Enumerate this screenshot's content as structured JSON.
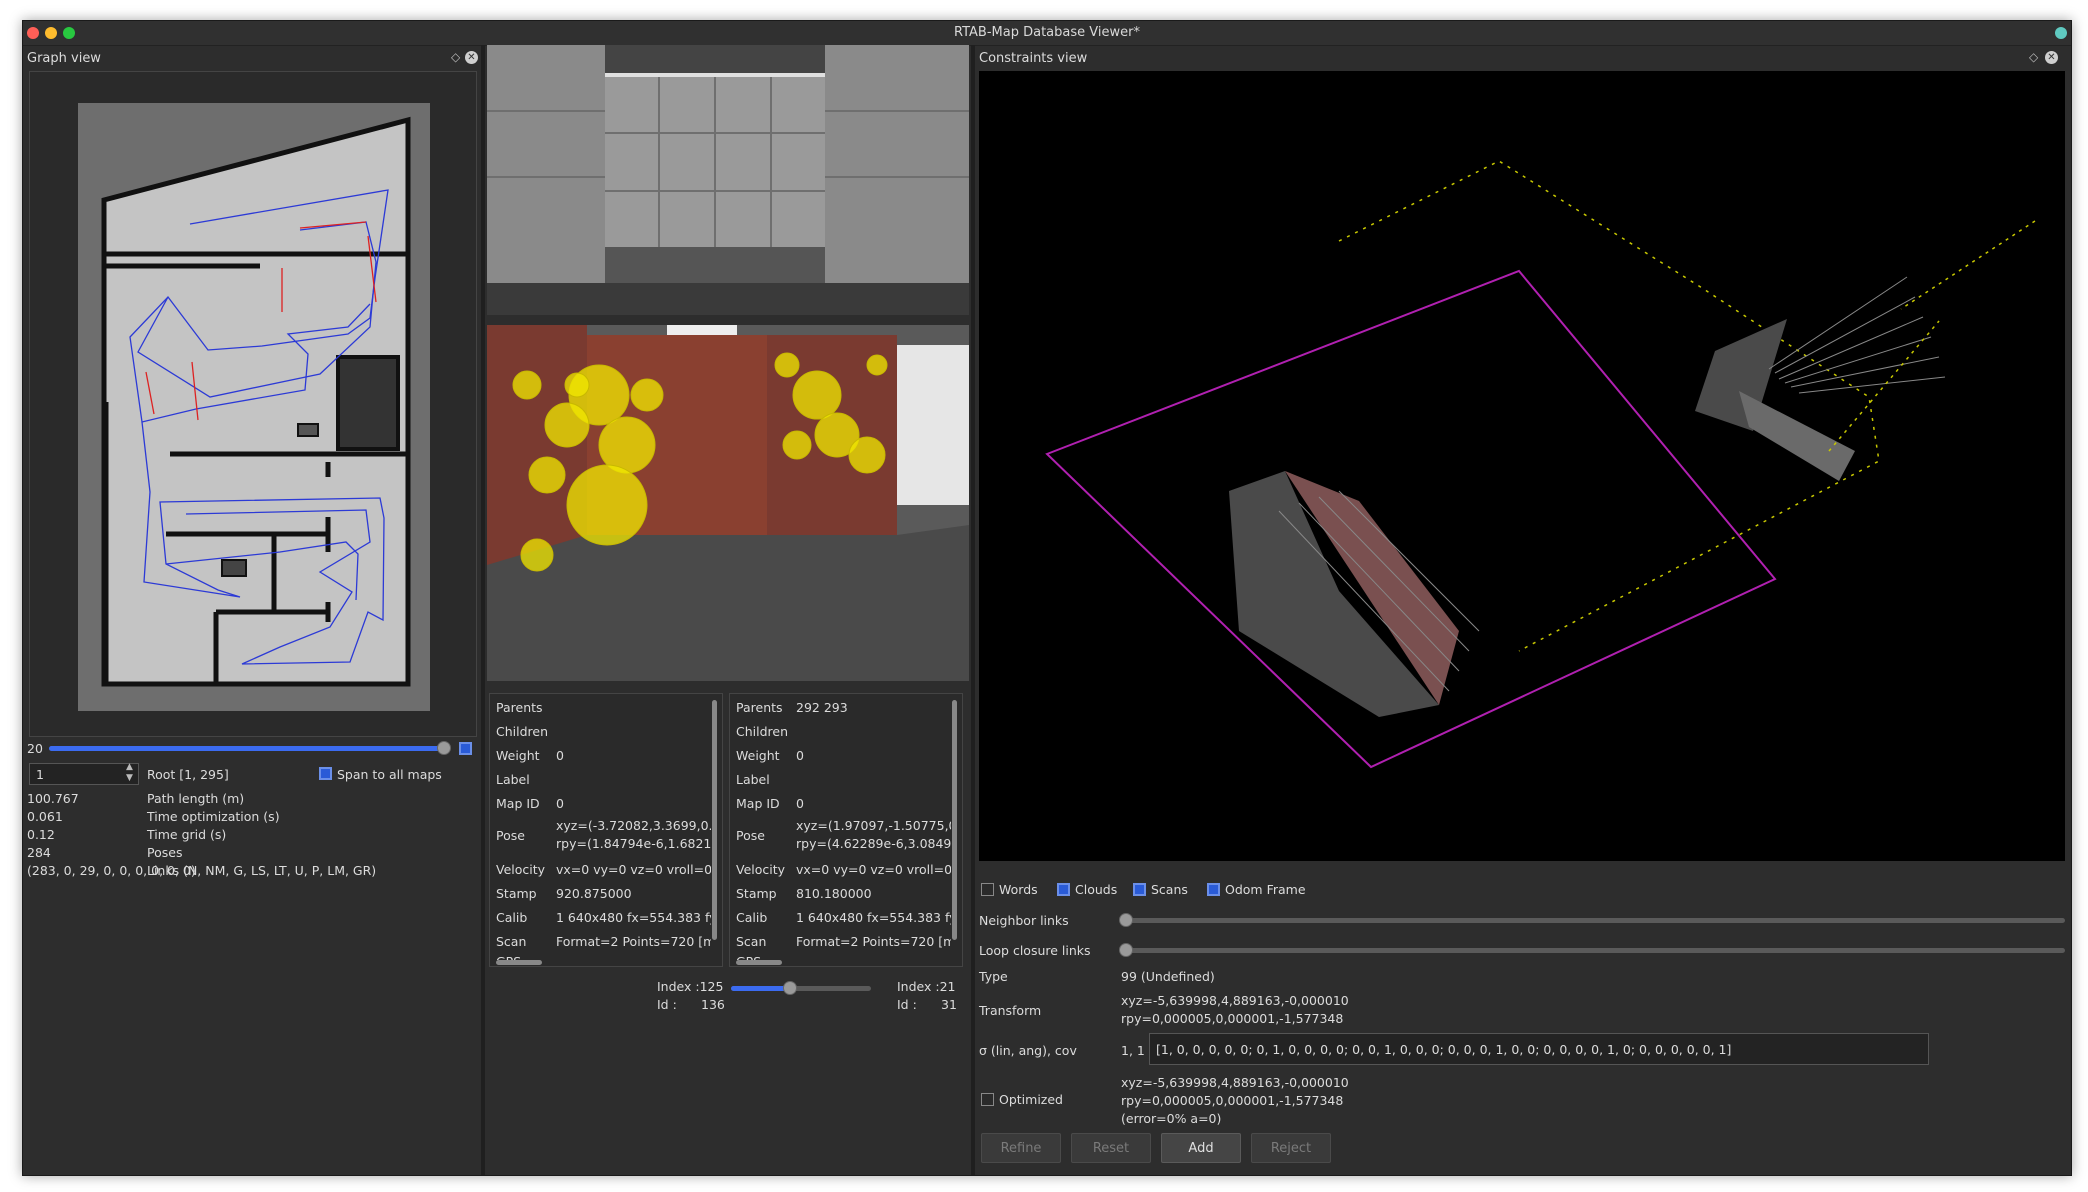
{
  "window": {
    "title": "RTAB-Map Database Viewer*"
  },
  "graph_view": {
    "title": "Graph view",
    "slider_value": "20",
    "spin_value": "1",
    "root_label": "Root [1, 295]",
    "span_label": "Span to all maps",
    "stats": [
      {
        "value": "100.767",
        "label": "Path length (m)"
      },
      {
        "value": "0.061",
        "label": "Time optimization (s)"
      },
      {
        "value": "0.12",
        "label": "Time grid (s)"
      },
      {
        "value": "284",
        "label": "Poses"
      },
      {
        "value": "(283, 0, 29, 0, 0, 0, 0, 0, 0)",
        "label": "Links (N, NM, G, LS, LT, U, P, LM, GR)"
      }
    ]
  },
  "node_a": {
    "rows": [
      {
        "key": "Parents",
        "value": ""
      },
      {
        "key": "Children",
        "value": ""
      },
      {
        "key": "Weight",
        "value": "0"
      },
      {
        "key": "Label",
        "value": ""
      },
      {
        "key": "Map ID",
        "value": "0"
      },
      {
        "key": "Pose",
        "value": "xyz=(-3.72082,3.3699,0.1(",
        "value2": "rpy=(1.84794e-6,1.68211e"
      },
      {
        "key": "Velocity",
        "value": "vx=0 vy=0 vz=0 vroll=0 vp"
      },
      {
        "key": "Stamp",
        "value": "920.875000"
      },
      {
        "key": "Calib",
        "value": "1 640x480 fx=554.383 fy="
      },
      {
        "key": "Scan",
        "value": "Format=2 Points=720 [ma"
      },
      {
        "key": "GPS",
        "value": ""
      }
    ],
    "index_label": "Index :125",
    "id_label": "Id :",
    "id_value": "136",
    "slider_fraction": 0.42
  },
  "node_b": {
    "rows": [
      {
        "key": "Parents",
        "value": "292 293"
      },
      {
        "key": "Children",
        "value": ""
      },
      {
        "key": "Weight",
        "value": "0"
      },
      {
        "key": "Label",
        "value": ""
      },
      {
        "key": "Map ID",
        "value": "0"
      },
      {
        "key": "Pose",
        "value": "xyz=(1.97097,-1.50775,0.1",
        "value2": "rpy=(4.62289e-6,3.0849e-"
      },
      {
        "key": "Velocity",
        "value": "vx=0 vy=0 vz=0 vroll=0 vp"
      },
      {
        "key": "Stamp",
        "value": "810.180000"
      },
      {
        "key": "Calib",
        "value": "1 640x480 fx=554.383 fy="
      },
      {
        "key": "Scan",
        "value": "Format=2 Points=720 [ma"
      },
      {
        "key": "GPS",
        "value": ""
      }
    ],
    "index_label": "Index :21",
    "id_label": "Id :",
    "id_value": "31",
    "slider_fraction": 0.07
  },
  "constraints_view": {
    "title": "Constraints view",
    "checkboxes": [
      {
        "label": "Words",
        "checked": false
      },
      {
        "label": "Clouds",
        "checked": true
      },
      {
        "label": "Scans",
        "checked": true
      },
      {
        "label": "Odom Frame",
        "checked": true
      }
    ],
    "neighbor_links": "Neighbor links",
    "loop_closure_links": "Loop closure links",
    "type_label": "Type",
    "type_value": "99  (Undefined)",
    "transform_label": "Transform",
    "transform_xyz": "xyz=-5,639998,4,889163,-0,000010",
    "transform_rpy": "rpy=0,000005,0,000001,-1,577348",
    "sigma_label": "σ (lin, ang), cov",
    "sigma_index": "1, 1",
    "cov_value": "[1, 0, 0, 0, 0, 0;  0, 1, 0, 0, 0, 0;  0, 0, 1, 0, 0, 0;  0, 0, 0, 1, 0, 0;  0, 0, 0, 0, 1, 0;  0, 0, 0, 0, 0, 1]",
    "optimized_label": "Optimized",
    "optimized_xyz": "xyz=-5,639998,4,889163,-0,000010",
    "optimized_rpy": "rpy=0,000005,0,000001,-1,577348",
    "optimized_error": "(error=0% a=0)",
    "buttons": {
      "refine": "Refine",
      "reset": "Reset",
      "add": "Add",
      "reject": "Reject"
    }
  },
  "colors": {
    "accent": "#3b6bf0",
    "background": "#2d2d2d"
  }
}
